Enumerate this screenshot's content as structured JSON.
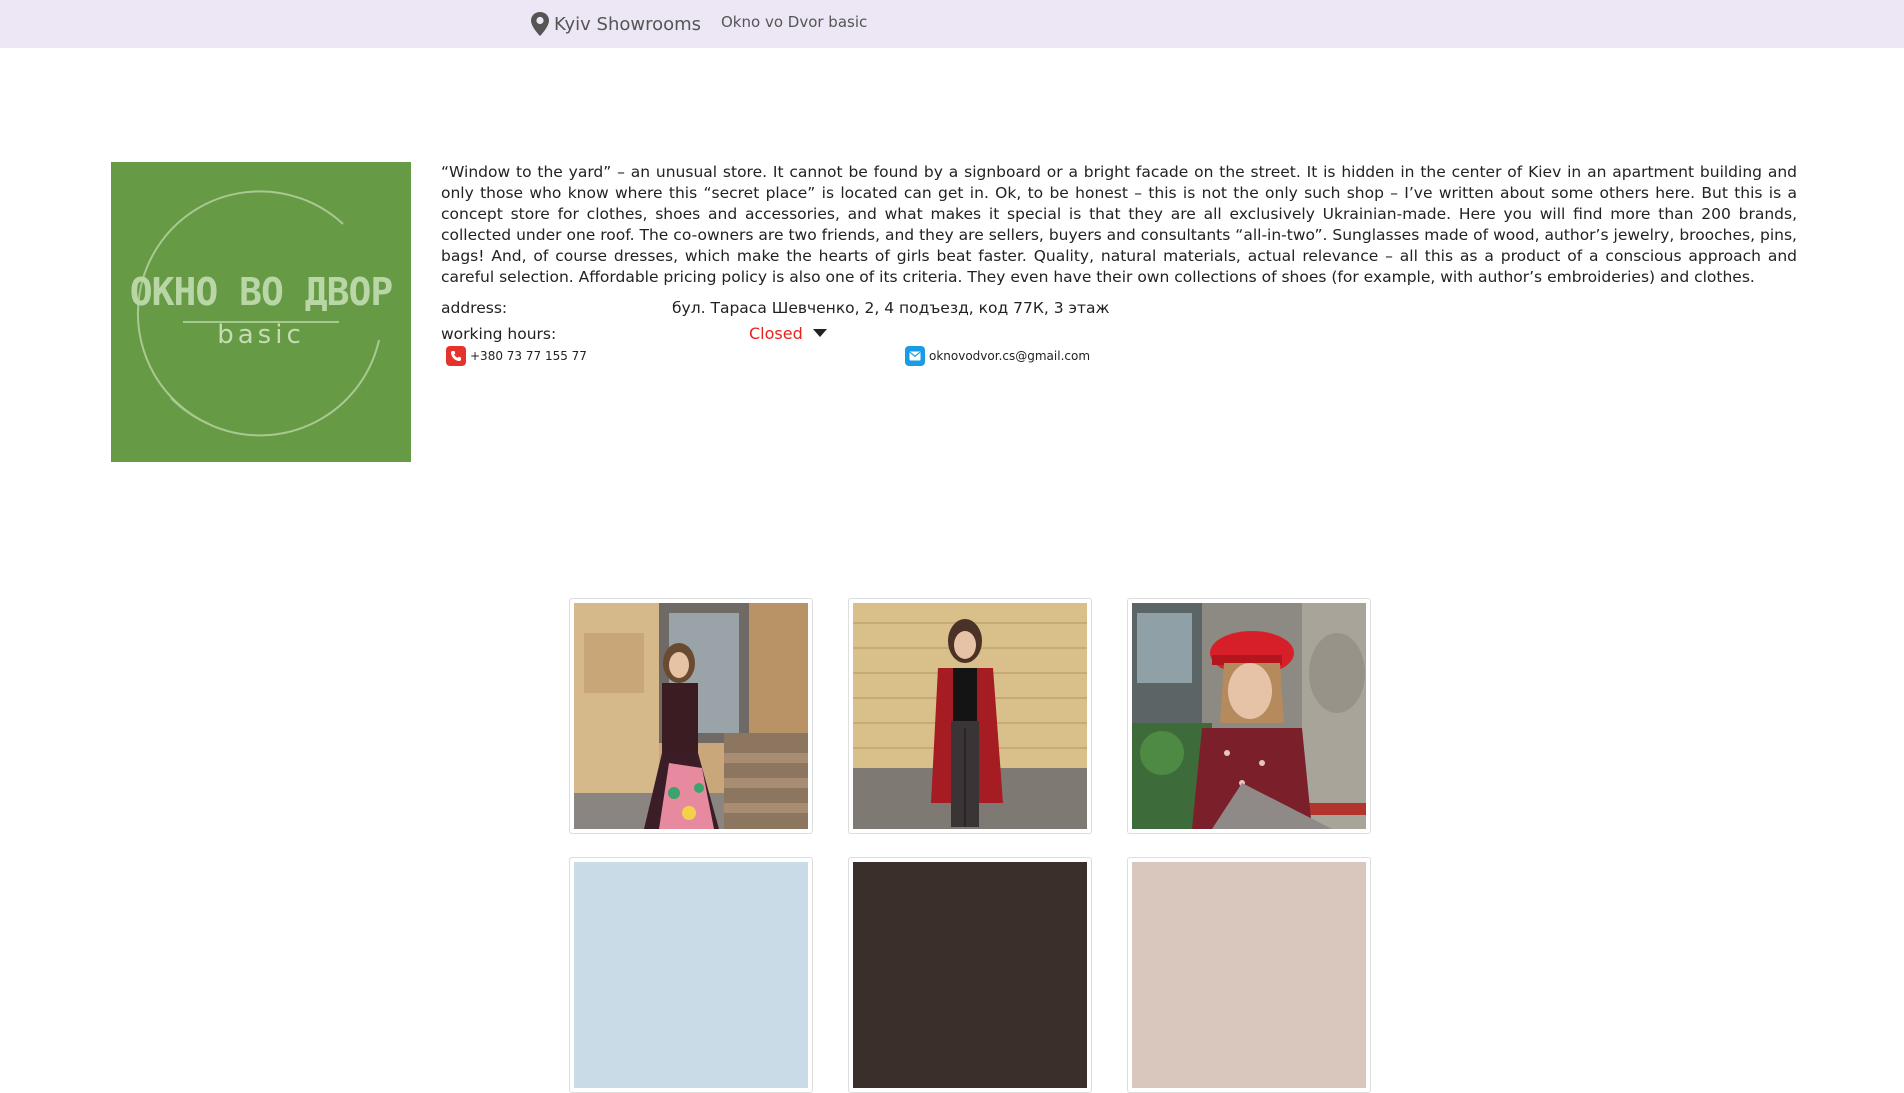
{
  "navbar": {
    "brand": "Kyiv Showrooms",
    "brand_icon": "map-pin-icon",
    "current_page": "Okno vo Dvor basic"
  },
  "logo": {
    "title": "ОКНО ВО ДВОР",
    "subtitle": "basic",
    "background": "#679a45"
  },
  "description": "“Window to the yard” – an unusual store. It cannot be found by a signboard or a bright facade on the street. It is hidden in the center of Kiev in an apartment building and only those who know where this “secret place” is located can get in. Ok, to be honest – this is not the only such shop – I’ve written about some others here. But this is a concept store for clothes, shoes and accessories, and what makes it special is that they are all exclusively Ukrainian-made. Here you will find more than 200 brands, collected under one roof. The co-owners are two friends, and they are sellers, buyers and consultants “all-in-two”. Sunglasses made of wood, author’s jewelry, brooches, pins, bags! And, of course dresses, which make the hearts of girls beat faster. Quality, natural materials, actual relevance – all this as a product of a conscious approach and careful selection. Affordable pricing policy is also one of its criteria. They even have their own collections of shoes (for example, with author’s embroideries) and clothes.",
  "info": {
    "address_label": "address:",
    "address_value": "бул. Тараса Шевченко, 2, 4 подъезд, код 77К, 3 этаж",
    "hours_label": "working hours:",
    "hours_status": "Closed",
    "status_color": "#e8231d",
    "phone": "+380 73 77 155 77",
    "phone_icon": "phone-icon",
    "email": "oknovodvor.cs@gmail.com",
    "email_icon": "mail-icon"
  },
  "gallery": {
    "photos": [
      "photo-woman-dress-steps",
      "photo-woman-red-coat-brick-wall",
      "photo-woman-red-cap",
      "photo-4",
      "photo-5",
      "photo-6"
    ]
  }
}
